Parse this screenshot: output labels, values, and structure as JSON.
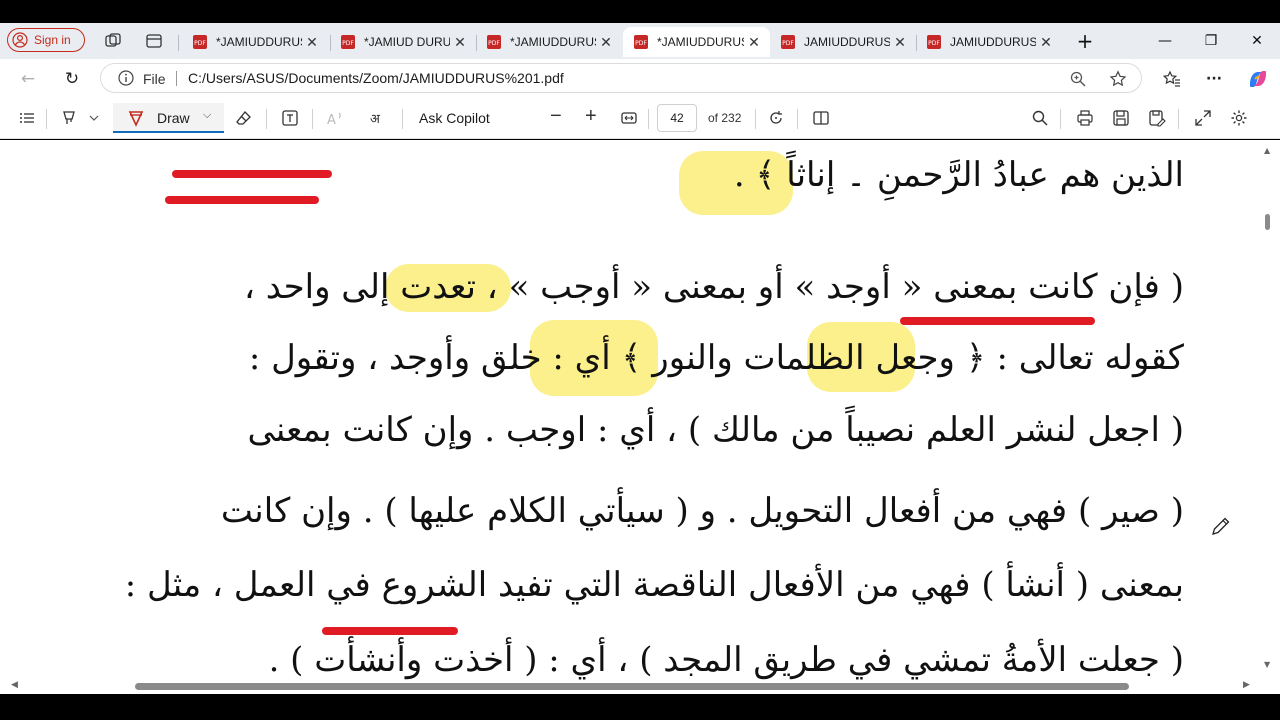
{
  "browser": {
    "sign_in_label": "Sign in",
    "tabs": [
      {
        "title": "*JAMIUDDURUS",
        "active": false
      },
      {
        "title": "*JAMIUD DURUS",
        "active": false
      },
      {
        "title": "*JAMIUDDURUS",
        "active": false
      },
      {
        "title": "*JAMIUDDURUS",
        "active": true
      },
      {
        "title": "JAMIUDDURUS",
        "active": false
      },
      {
        "title": "JAMIUDDURUS",
        "active": false
      }
    ],
    "file_label": "File",
    "url": "C:/Users/ASUS/Documents/Zoom/JAMIUDDURUS%201.pdf",
    "icons": {
      "new_tab": "+",
      "minimize": "—",
      "restore": "❐",
      "close": "✕",
      "back": "←",
      "reload": "↻",
      "more": "···",
      "tab_close": "✕"
    }
  },
  "pdf_toolbar": {
    "draw_label": "Draw",
    "ask_copilot_label": "Ask Copilot",
    "page_number": "42",
    "page_total": "of 232",
    "zoom_out": "−",
    "zoom_in": "+"
  },
  "document": {
    "lines": [
      "الذين هم عبادُ الرَّحمنِ ۔ إناثاً ﴾ .",
      "( فإن كانت بمعنى « أوجد » أو بمعنى « أوجب » ، تعدت إلى واحد ،",
      "كقوله تعالى : ﴿ وجعل الظلمات والنور ﴾ أي : خلق وأوجد ، وتقول :",
      "( اجعل لنشر العلم نصيباً من مالك ) ، أي : اوجب . وإن كانت بمعنى",
      "( صير ) فهي من أفعال التحويل . و ( سيأتي الكلام عليها ) . وإن كانت",
      "بمعنى ( أنشأ ) فهي من الأفعال الناقصة التي تفيد الشروع في العمل ، مثل :",
      "( جعلت الأمةُ تمشي في طريق المجد ) ، أي : ( أخذت وأنشأت ) ."
    ]
  },
  "colors": {
    "highlight": "#fbf08b",
    "ink_red": "#e01b24",
    "accent": "#0f6cbd"
  }
}
